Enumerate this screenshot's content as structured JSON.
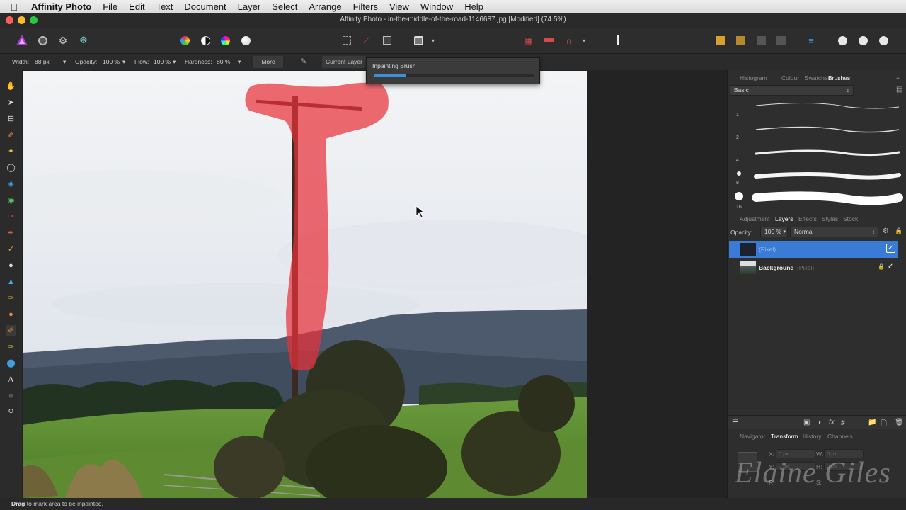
{
  "menubar": {
    "app": "Affinity Photo",
    "items": [
      "File",
      "Edit",
      "Text",
      "Document",
      "Layer",
      "Select",
      "Arrange",
      "Filters",
      "View",
      "Window",
      "Help"
    ]
  },
  "window": {
    "title": "Affinity Photo - in-the-middle-of-the-road-1146687.jpg [Modified] (74.5%)"
  },
  "context": {
    "width_label": "Width:",
    "width_value": "88 px",
    "opacity_label": "Opacity:",
    "opacity_value": "100 %",
    "flow_label": "Flow:",
    "flow_value": "100 %",
    "hardness_label": "Hardness:",
    "hardness_value": "80 %",
    "more": "More",
    "source": "Current Layer"
  },
  "popup": {
    "title": "Inpainting Brush",
    "progress": 0.2
  },
  "panel": {
    "top_tabs": [
      "Histogram",
      "Colour",
      "Swatches",
      "Brushes"
    ],
    "brush_category": "Basic",
    "brush_sizes": [
      "1",
      "2",
      "4",
      "8",
      "16"
    ],
    "layer_tabs": [
      "Adjustment",
      "Layers",
      "Effects",
      "Styles",
      "Stock"
    ],
    "opacity_label": "Opacity:",
    "opacity_value": "100 %",
    "blend_mode": "Normal",
    "layers": [
      {
        "name": "",
        "type": "(Pixel)",
        "selected": true
      },
      {
        "name": "Background",
        "type": "(Pixel)",
        "selected": false
      }
    ],
    "bottom_tabs": [
      "Navigator",
      "Transform",
      "History",
      "Channels"
    ],
    "transform": {
      "x_label": "X:",
      "x_value": "0 px",
      "y_label": "Y:",
      "y_value": "0 px",
      "w_label": "W:",
      "w_value": "0 px",
      "h_label": "H:",
      "h_value": "0 px",
      "r_label": "R:",
      "s_label": "S:"
    },
    "watermark": "Elaine Giles"
  },
  "status": {
    "bold": "Drag",
    "text": "to mark area to be inpainted."
  },
  "colors": {
    "accent": "#3c8fe0",
    "mask": "#e8323a"
  }
}
